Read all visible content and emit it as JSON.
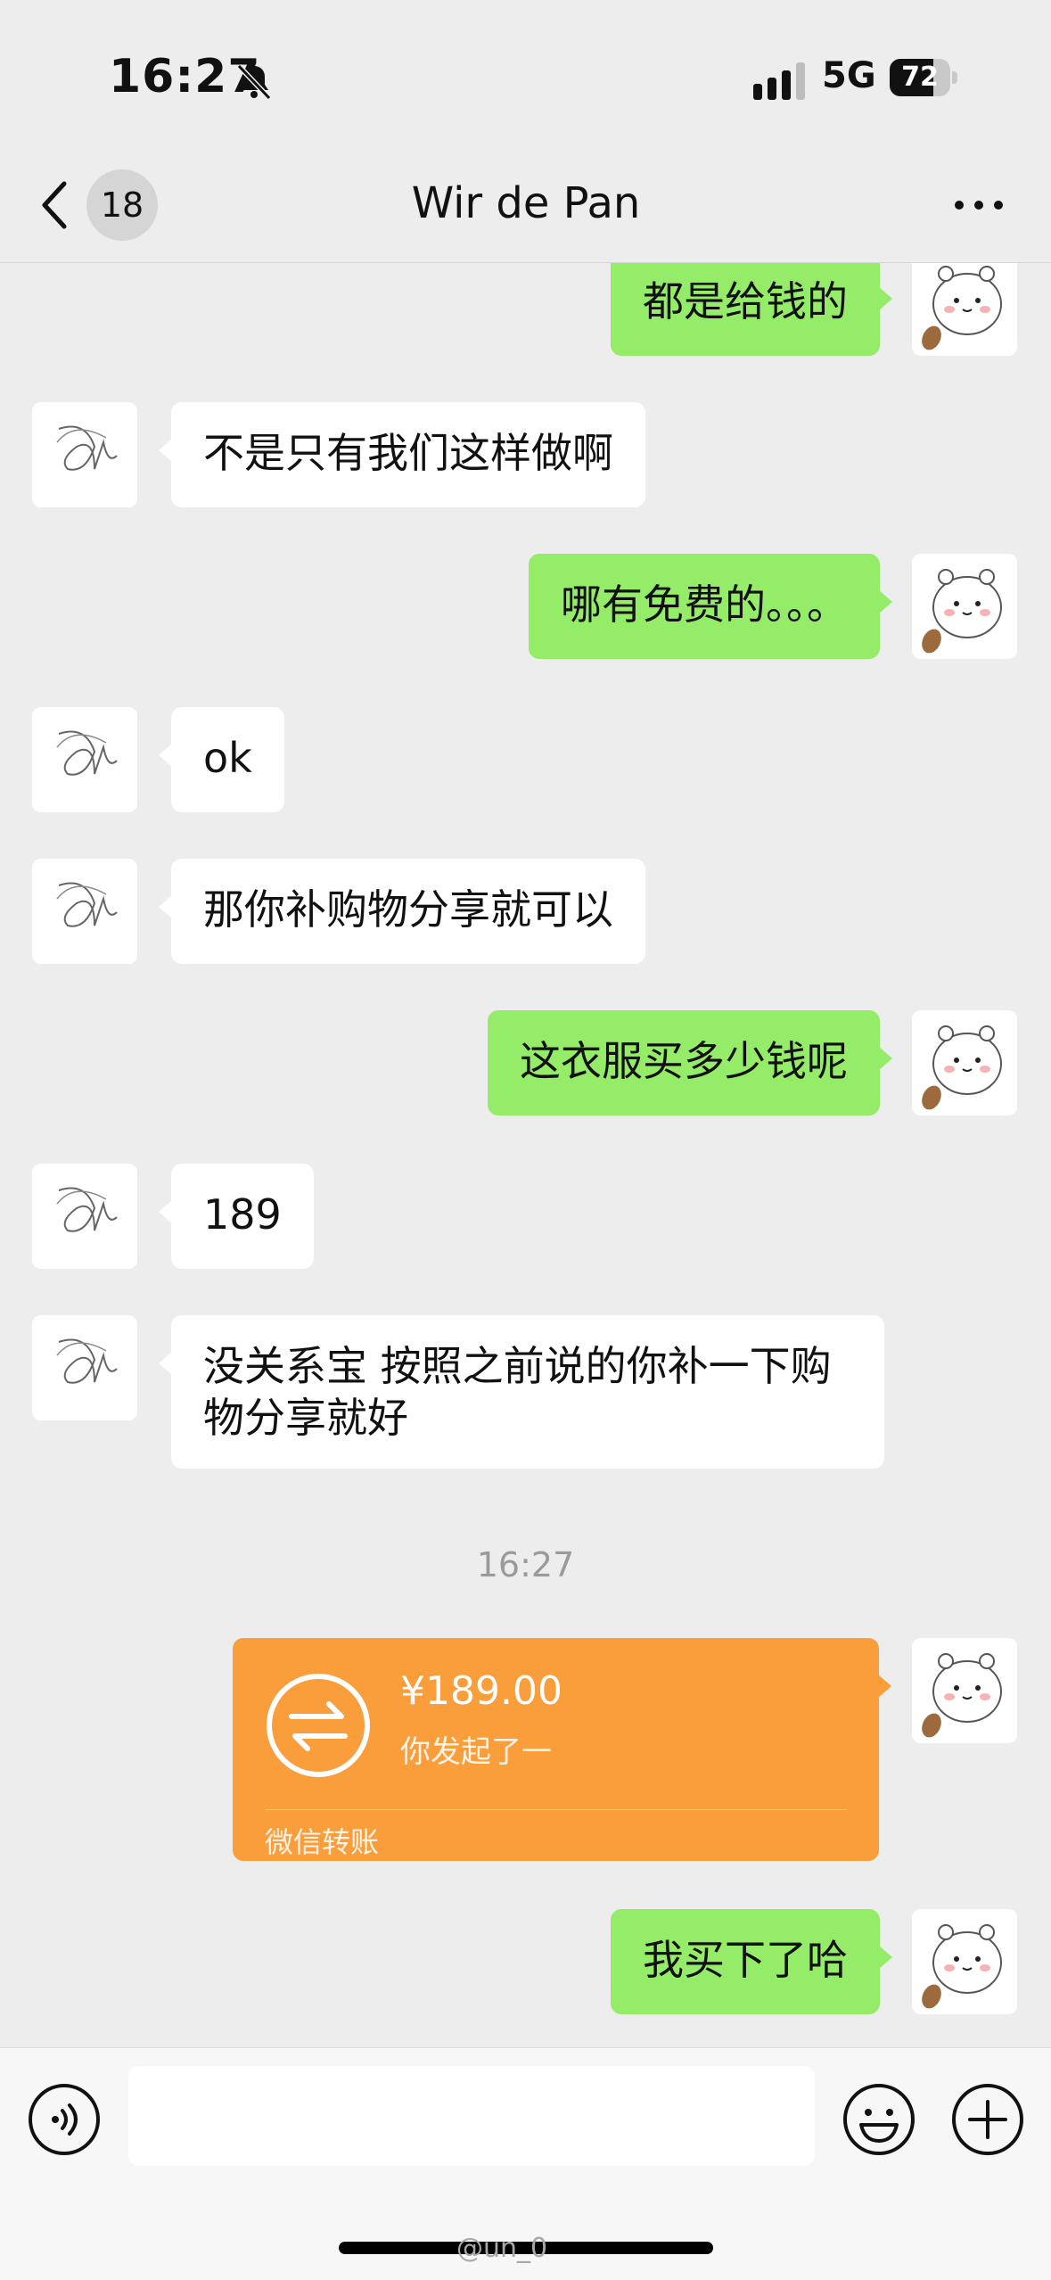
{
  "status_bar": {
    "time": "16:27",
    "network": "5G",
    "battery": "72",
    "battery_fraction": 0.72
  },
  "nav": {
    "unread_count": "18",
    "title": "Wir de Pan"
  },
  "messages": [
    {
      "side": "right",
      "text": "都是给钱的"
    },
    {
      "side": "left",
      "text": "不是只有我们这样做啊"
    },
    {
      "side": "right",
      "text": "哪有免费的。。。"
    },
    {
      "side": "left",
      "text": "ok"
    },
    {
      "side": "left",
      "text": "那你补购物分享就可以"
    },
    {
      "side": "right",
      "text": "这衣服买多少钱呢"
    },
    {
      "side": "left",
      "text": "189"
    },
    {
      "side": "left",
      "text": "没关系宝 按照之前说的你补一下购物分享就好"
    }
  ],
  "timestamp": "16:27",
  "transfer": {
    "amount": "¥189.00",
    "status": "你发起了一",
    "label": "微信转账"
  },
  "last_message": {
    "side": "right",
    "text": "我买下了哈"
  },
  "watermark": "@un_0",
  "colors": {
    "sent_bubble": "#95ec69",
    "received_bubble": "#ffffff",
    "transfer_card": "#fa9d3b",
    "background": "#ededed"
  }
}
